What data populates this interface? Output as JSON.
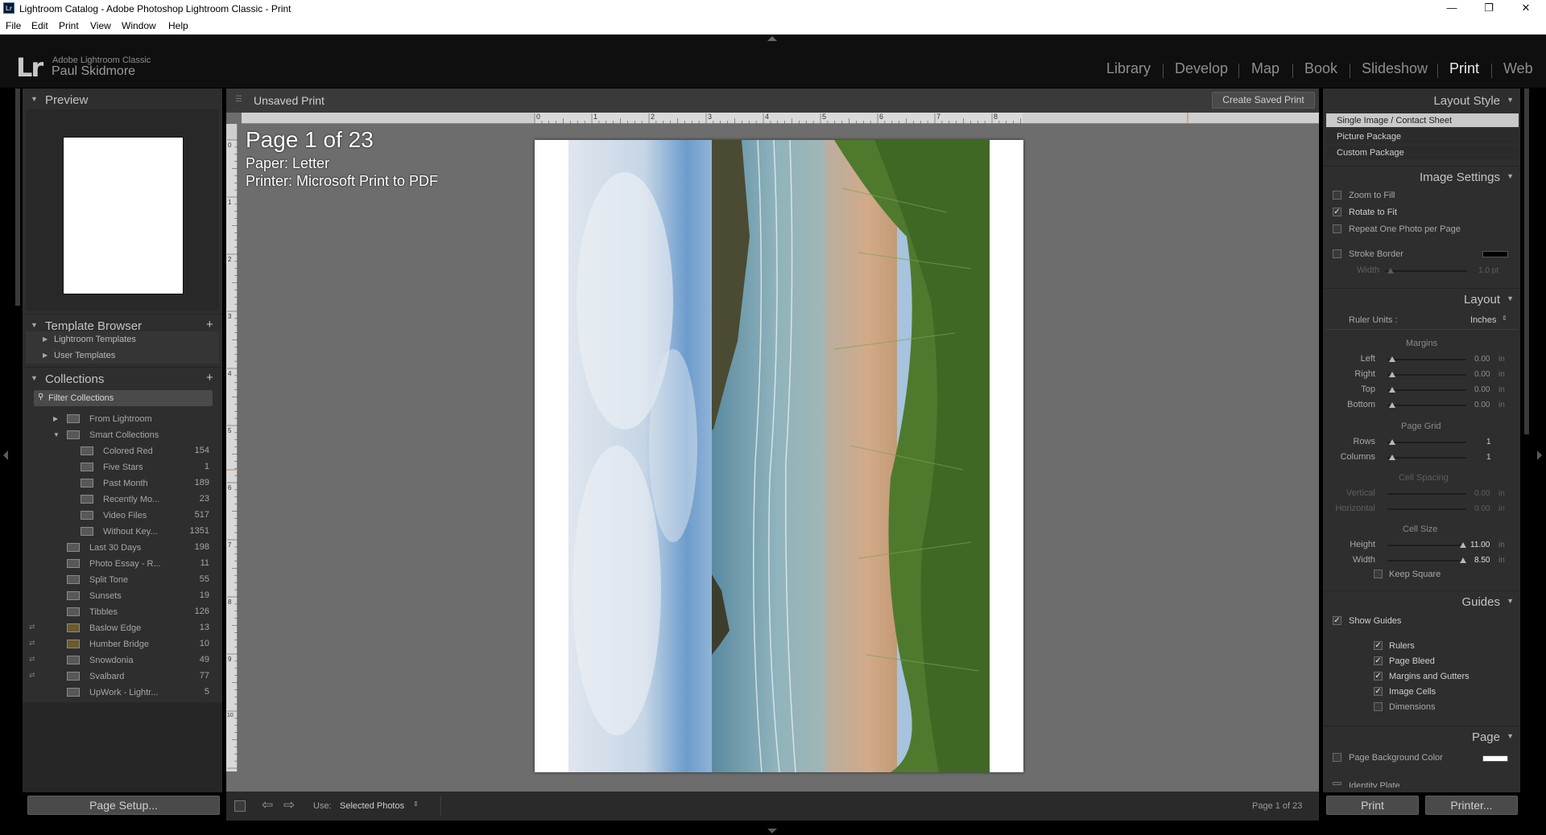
{
  "window": {
    "title": "Lightroom Catalog - Adobe Photoshop Lightroom Classic - Print",
    "app_icon": "Lr"
  },
  "menu": [
    "File",
    "Edit",
    "Print",
    "View",
    "Window",
    "Help"
  ],
  "identity": {
    "logo": "Lr",
    "product": "Adobe Lightroom Classic",
    "user": "Paul Skidmore"
  },
  "modules": [
    "Library",
    "Develop",
    "Map",
    "Book",
    "Slideshow",
    "Print",
    "Web"
  ],
  "active_module": "Print",
  "left": {
    "preview_title": "Preview",
    "template_browser_title": "Template Browser",
    "templates": [
      "Lightroom Templates",
      "User Templates"
    ],
    "collections_title": "Collections",
    "filter_placeholder": "Filter Collections",
    "collections": [
      {
        "name": "From Lightroom",
        "count": ""
      },
      {
        "name": "Smart Collections",
        "count": ""
      },
      {
        "name": "Colored Red",
        "count": "154"
      },
      {
        "name": "Five Stars",
        "count": "1"
      },
      {
        "name": "Past Month",
        "count": "189"
      },
      {
        "name": "Recently Mo...",
        "count": "23"
      },
      {
        "name": "Video Files",
        "count": "517"
      },
      {
        "name": "Without Key...",
        "count": "1351"
      },
      {
        "name": "Last 30 Days",
        "count": "198"
      },
      {
        "name": "Photo Essay - R...",
        "count": "11"
      },
      {
        "name": "Split Tone",
        "count": "55"
      },
      {
        "name": "Sunsets",
        "count": "19"
      },
      {
        "name": "Tibbles",
        "count": "126"
      },
      {
        "name": "Baslow Edge",
        "count": "13"
      },
      {
        "name": "Humber Bridge",
        "count": "10"
      },
      {
        "name": "Snowdonia",
        "count": "49"
      },
      {
        "name": "Svalbard",
        "count": "77"
      },
      {
        "name": "UpWork - Lightr...",
        "count": "5"
      }
    ],
    "page_setup": "Page Setup..."
  },
  "center": {
    "print_name": "Unsaved Print",
    "create_saved": "Create Saved Print",
    "page_info": "Page 1 of 23",
    "paper": "Paper:  Letter",
    "printer": "Printer:  Microsoft Print to PDF",
    "ruler_top": [
      "0",
      "1",
      "2",
      "3",
      "4",
      "5",
      "6",
      "7",
      "8"
    ],
    "ruler_left": [
      "0",
      "1",
      "2",
      "3",
      "4",
      "5",
      "6",
      "7",
      "8",
      "9",
      "10"
    ]
  },
  "toolbar": {
    "use_label": "Use:",
    "use_value": "Selected Photos",
    "page_count": "Page 1 of 23"
  },
  "right": {
    "layout_style_title": "Layout Style",
    "layout_styles": [
      "Single Image / Contact Sheet",
      "Picture Package",
      "Custom Package"
    ],
    "image_settings_title": "Image Settings",
    "zoom_to_fill": "Zoom to Fill",
    "rotate_to_fit": "Rotate to Fit",
    "repeat_one": "Repeat One Photo per Page",
    "stroke_border": "Stroke Border",
    "stroke_width_label": "Width",
    "stroke_width_value": "1.0 pt",
    "layout_title": "Layout",
    "ruler_units_label": "Ruler Units :",
    "ruler_units_value": "Inches",
    "margins_title": "Margins",
    "margins": [
      {
        "label": "Left",
        "value": "0.00"
      },
      {
        "label": "Right",
        "value": "0.00"
      },
      {
        "label": "Top",
        "value": "0.00"
      },
      {
        "label": "Bottom",
        "value": "0.00"
      }
    ],
    "page_grid_title": "Page Grid",
    "grid": [
      {
        "label": "Rows",
        "value": "1"
      },
      {
        "label": "Columns",
        "value": "1"
      }
    ],
    "cell_spacing_title": "Cell Spacing",
    "spacing": [
      {
        "label": "Vertical",
        "value": "0.00"
      },
      {
        "label": "Horizontal",
        "value": "0.00"
      }
    ],
    "cell_size_title": "Cell Size",
    "cell_size": [
      {
        "label": "Height",
        "value": "11.00"
      },
      {
        "label": "Width",
        "value": "8.50"
      }
    ],
    "keep_square": "Keep Square",
    "unit_in": "in",
    "guides_title": "Guides",
    "show_guides": "Show Guides",
    "guides": [
      "Rulers",
      "Page Bleed",
      "Margins and Gutters",
      "Image Cells",
      "Dimensions"
    ],
    "page_title": "Page",
    "page_bg": "Page Background Color",
    "identity_plate": "Identity Plate",
    "print_button": "Print",
    "printer_button": "Printer..."
  },
  "colors": {
    "panel": "#2e2e2e",
    "canvas": "#6d6d6d",
    "accent_active": "#ececec"
  }
}
